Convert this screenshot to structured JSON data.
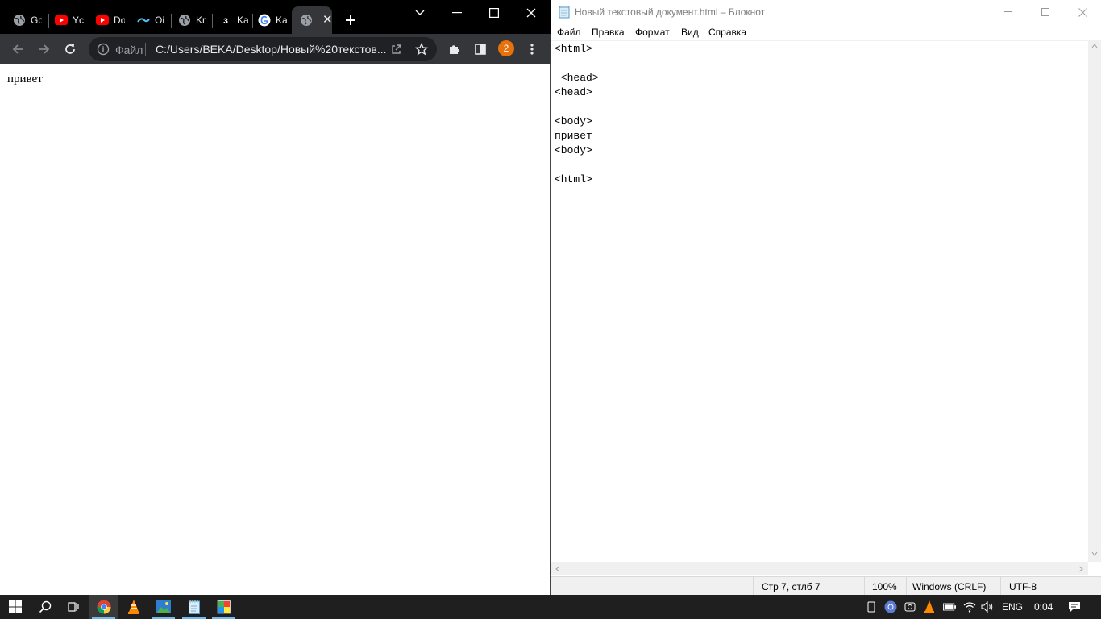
{
  "chrome": {
    "tabs": [
      {
        "title": "Gc",
        "favicon": "globe-icon"
      },
      {
        "title": "Yc",
        "favicon": "youtube-icon"
      },
      {
        "title": "Do",
        "favicon": "youtube-icon"
      },
      {
        "title": "Oi",
        "favicon": "wave-icon"
      },
      {
        "title": "Kr",
        "favicon": "globe-icon"
      },
      {
        "title": "Ka",
        "favicon": "letter-z-icon"
      },
      {
        "title": "Ka",
        "favicon": "google-icon"
      },
      {
        "title": "",
        "favicon": "globe-icon",
        "active": true
      }
    ],
    "toolbar": {
      "site_info_label": "Файл",
      "url": "C:/Users/BEKA/Desktop/Новый%20текстов...",
      "profile_badge": "2"
    },
    "page": {
      "body_text": "привет"
    }
  },
  "notepad": {
    "title": "Новый текстовый документ.html – Блокнот",
    "menu": [
      "Файл",
      "Правка",
      "Формат",
      "Вид",
      "Справка"
    ],
    "lines": [
      "<html>",
      "",
      " <head>",
      "<head>",
      "",
      "<body>",
      "привет",
      "<body>",
      "",
      "<html>"
    ],
    "status": {
      "position": "Стр 7, стлб 7",
      "zoom": "100%",
      "line_endings": "Windows (CRLF)",
      "encoding": "UTF-8"
    }
  },
  "taskbar": {
    "apps": [
      "start-icon",
      "search-icon",
      "task-view-icon",
      "chrome-icon",
      "vlc-icon",
      "photos-icon",
      "notepad-icon",
      "paint-icon"
    ],
    "language": "ENG",
    "clock": "0:04"
  },
  "colors": {
    "chrome_frame": "#000000",
    "chrome_toolbar": "#35363a",
    "omnibox": "#202124",
    "profile_badge": "#e8710a",
    "taskbar": "#1f1f1f",
    "taskbar_indicator": "#76b9ed"
  }
}
